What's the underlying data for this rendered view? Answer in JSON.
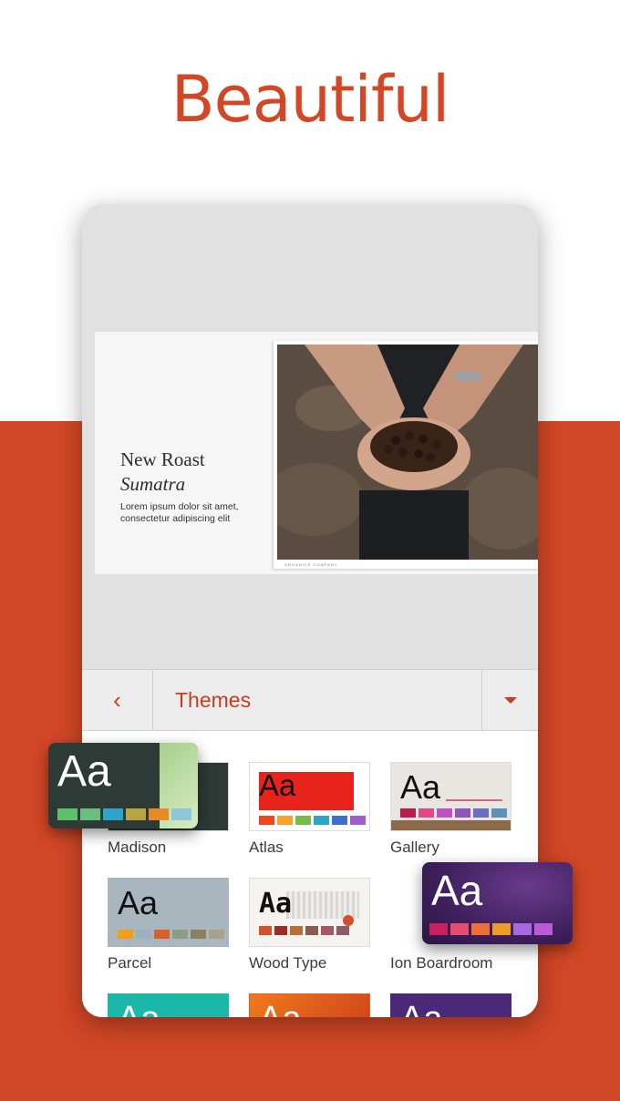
{
  "headline": "Beautiful",
  "slide": {
    "title": "New Roast",
    "subtitle": "Sumatra",
    "body": "Lorem ipsum dolor sit amet, consectetur adipiscing elit",
    "photo_caption": "ORGANICS COMPANY"
  },
  "toolbar": {
    "title": "Themes",
    "back_glyph": "‹"
  },
  "themes": {
    "sample_text": "Aa",
    "items": [
      {
        "label": "Madison",
        "swatches": [
          "#5fc06a",
          "#6bbf7e",
          "#2da4c9",
          "#b7a544",
          "#e88a2a",
          "#8ec7d9"
        ]
      },
      {
        "label": "Atlas",
        "swatches": [
          "#f0441b",
          "#f7a12b",
          "#74bd4a",
          "#2fa6c6",
          "#3f6fcd",
          "#9f5ecb"
        ]
      },
      {
        "label": "Gallery",
        "swatches": [
          "#b91b4b",
          "#e64686",
          "#c14fc2",
          "#8f55b9",
          "#6c6fc0",
          "#5b90b8"
        ]
      },
      {
        "label": "Parcel",
        "swatches": [
          "#f29e1c",
          "#9bb1be",
          "#d6622b",
          "#8e9d80",
          "#8a8160",
          "#aaa18a"
        ]
      },
      {
        "label": "Wood Type",
        "swatches": [
          "#d4502b",
          "#9b2c27",
          "#b46f3a",
          "#8a5a52",
          "#a35968",
          "#8d5b64"
        ]
      },
      {
        "label": "Ion Boardroom",
        "swatches": [
          "#c8205d",
          "#e84b72",
          "#ef6d37",
          "#ee9b29",
          "#a56ae0",
          "#bb5bd8"
        ]
      }
    ]
  },
  "colors": {
    "accent": "#d24726",
    "toolbar_text": "#c43e1c"
  }
}
